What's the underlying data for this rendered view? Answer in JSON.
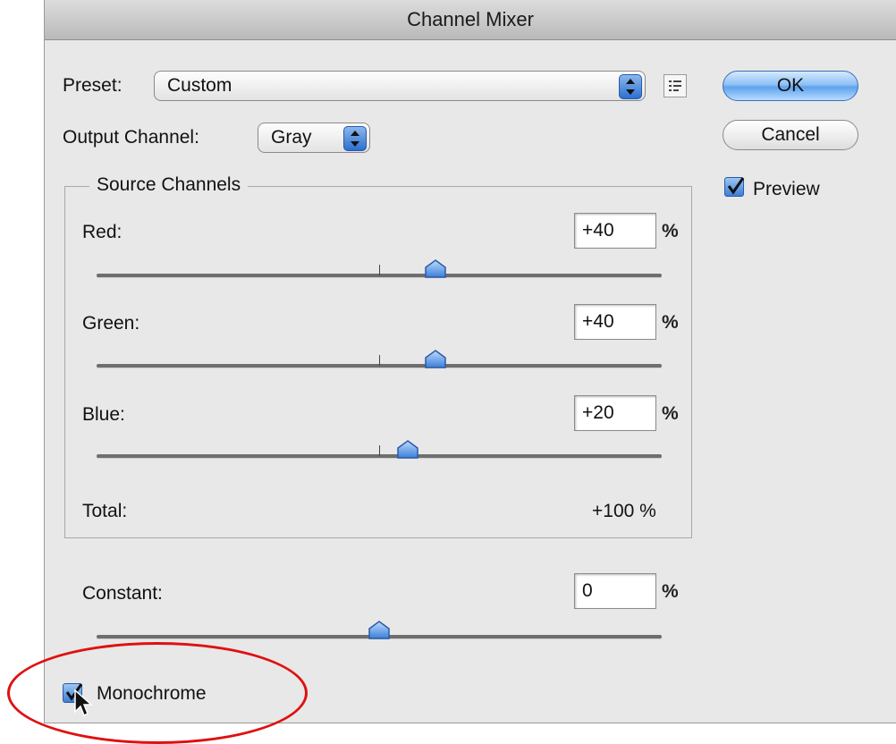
{
  "window": {
    "title": "Channel Mixer"
  },
  "preset": {
    "label": "Preset:",
    "value": "Custom"
  },
  "output_channel": {
    "label": "Output Channel:",
    "value": "Gray"
  },
  "buttons": {
    "ok": "OK",
    "cancel": "Cancel"
  },
  "preview": {
    "label": "Preview",
    "checked": true
  },
  "source_channels": {
    "title": "Source Channels",
    "channels": [
      {
        "name": "Red:",
        "value": "+40",
        "unit": "%",
        "level": 40
      },
      {
        "name": "Green:",
        "value": "+40",
        "unit": "%",
        "level": 40
      },
      {
        "name": "Blue:",
        "value": "+20",
        "unit": "%",
        "level": 20
      }
    ],
    "total": {
      "label": "Total:",
      "value": "+100 %"
    }
  },
  "constant": {
    "label": "Constant:",
    "value": "0",
    "unit": "%",
    "level": 0
  },
  "monochrome": {
    "label": "Monochrome",
    "checked": true
  },
  "slider_range": [
    -200,
    200
  ],
  "colors": {
    "accent": "#3d7fd6",
    "annotation": "#e01010"
  }
}
